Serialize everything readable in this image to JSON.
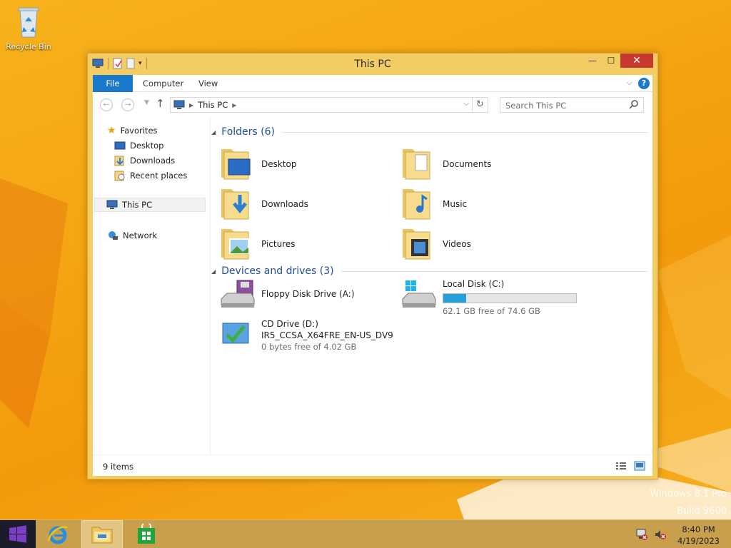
{
  "desktop": {
    "recycle_bin_label": "Recycle Bin"
  },
  "window": {
    "title": "This PC",
    "ribbon_tabs": [
      "File",
      "Computer",
      "View"
    ],
    "address": {
      "crumb": "This PC"
    },
    "search_placeholder": "Search This PC",
    "nav_pane": {
      "favorites": "Favorites",
      "desktop": "Desktop",
      "downloads": "Downloads",
      "recent_places": "Recent places",
      "this_pc": "This PC",
      "network": "Network"
    },
    "folders_header": "Folders (6)",
    "folders": [
      "Desktop",
      "Documents",
      "Downloads",
      "Music",
      "Pictures",
      "Videos"
    ],
    "devices_header": "Devices and drives (3)",
    "drives": {
      "floppy": {
        "name": "Floppy Disk Drive (A:)"
      },
      "local": {
        "name": "Local Disk (C:)",
        "free": "62.1 GB free of 74.6 GB",
        "used_fraction": 0.17
      },
      "cd": {
        "name": "CD Drive (D:)",
        "label": "IR5_CCSA_X64FRE_EN-US_DV9",
        "free": "0 bytes free of 4.02 GB"
      }
    },
    "status": "9 items"
  },
  "watermark": {
    "line1": "Windows 8.1 Pro",
    "line2": "Build 9600"
  },
  "taskbar": {
    "time": "8:40 PM",
    "date": "4/19/2023"
  },
  "colors": {
    "accent": "#1979ca",
    "close": "#c7392f",
    "usage_fill": "#26a0da"
  }
}
